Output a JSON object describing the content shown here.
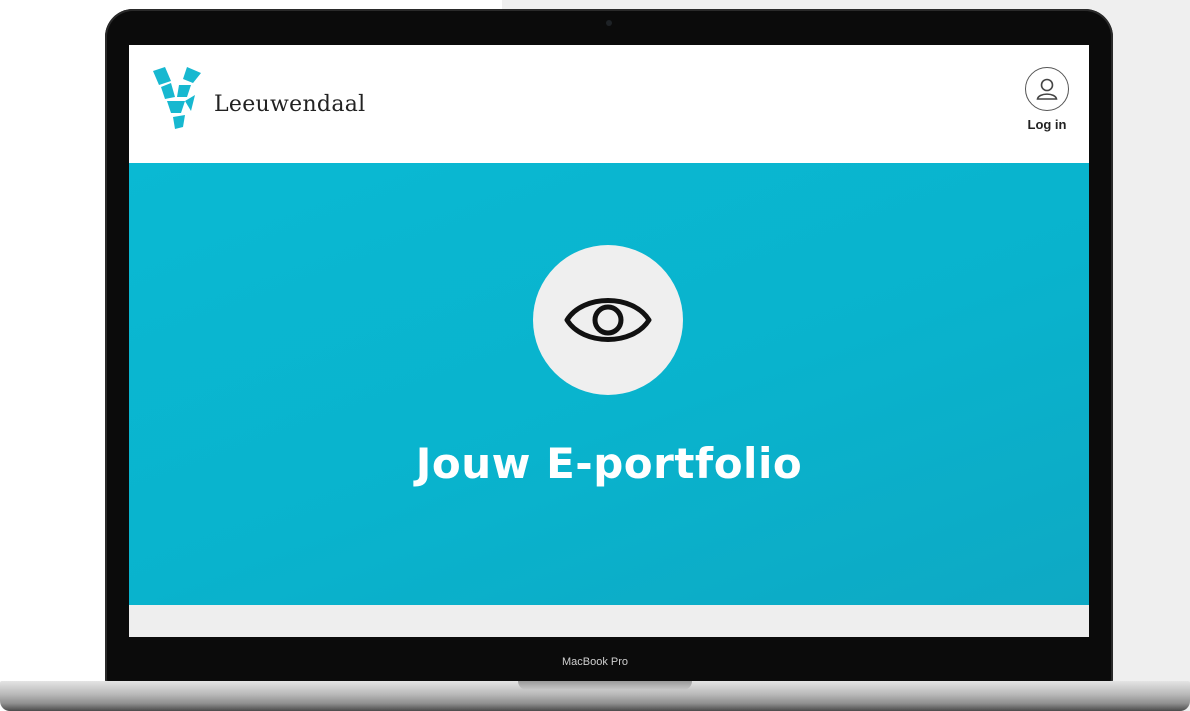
{
  "device": {
    "model_label": "MacBook Pro"
  },
  "header": {
    "brand": "Leeuwendaal",
    "login_label": "Log in",
    "login_icon": "user-icon"
  },
  "hero": {
    "icon": "eye-icon",
    "title": "Jouw E-portfolio"
  },
  "colors": {
    "hero_bg": "#0ab9d3",
    "logo": "#17b8d0",
    "icon_circle": "#efefef"
  }
}
